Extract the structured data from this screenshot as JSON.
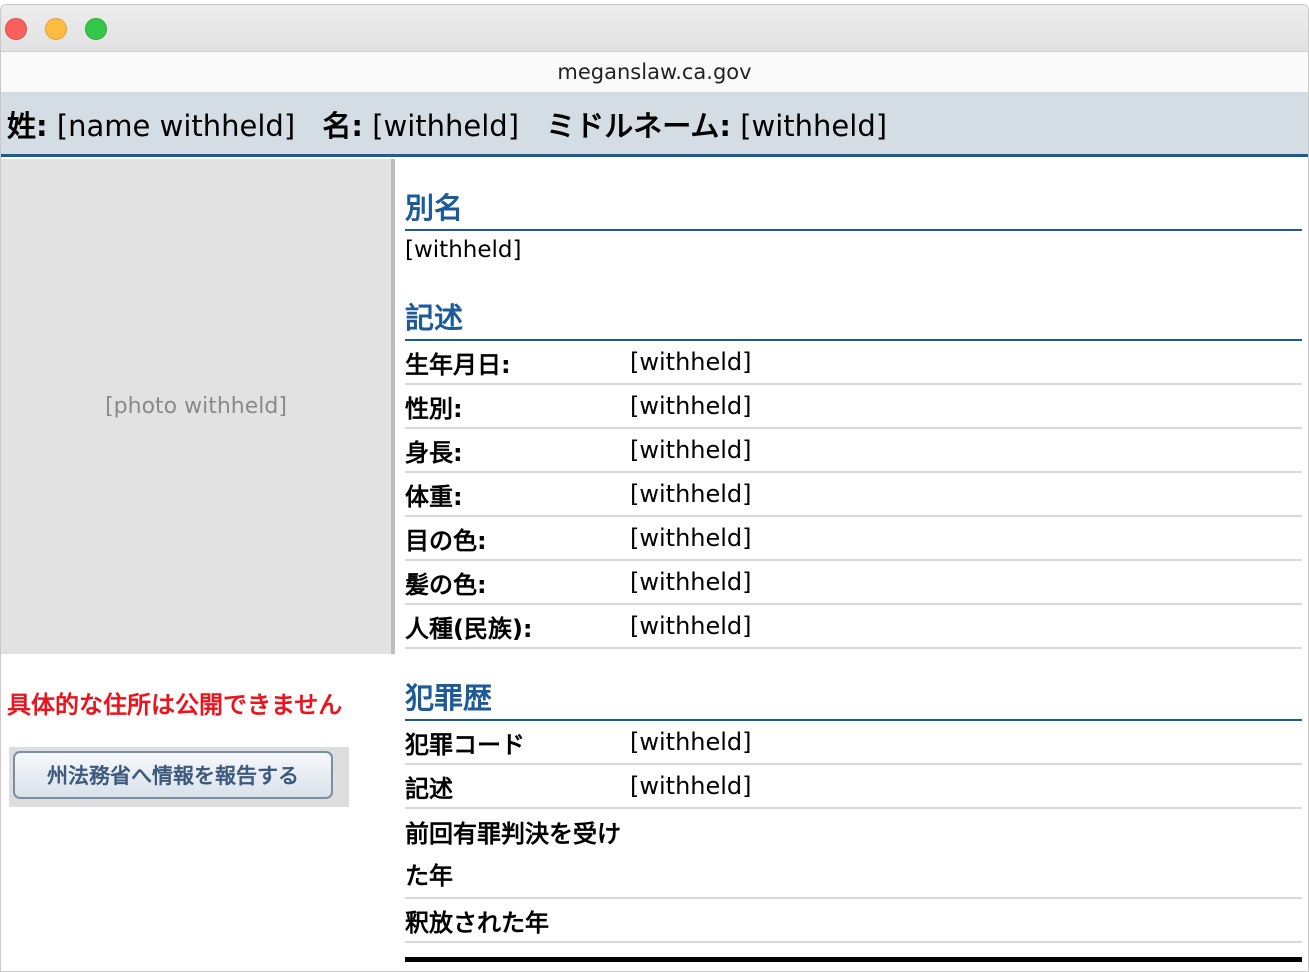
{
  "window": {
    "url": "meganslaw.ca.gov"
  },
  "name_bar": {
    "last_label": "姓:",
    "last_value": "[name withheld]",
    "first_label": "名:",
    "first_value": "[withheld]",
    "middle_label": "ミドルネーム:",
    "middle_value": "[withheld]"
  },
  "photo": {
    "placeholder": "[photo withheld]"
  },
  "notice": "具体的な住所は公開できません",
  "report_button": "州法務省へ情報を報告する",
  "aliases": {
    "title": "別名",
    "value": "[withheld]"
  },
  "description": {
    "title": "記述",
    "rows": [
      {
        "label": "生年月日:",
        "value": "[withheld]"
      },
      {
        "label": "性別:",
        "value": "[withheld]"
      },
      {
        "label": "身長:",
        "value": "[withheld]"
      },
      {
        "label": "体重:",
        "value": "[withheld]"
      },
      {
        "label": "目の色:",
        "value": "[withheld]"
      },
      {
        "label": "髪の色:",
        "value": "[withheld]"
      },
      {
        "label": "人種(民族):",
        "value": "[withheld]"
      }
    ]
  },
  "offenses": {
    "title": "犯罪歴",
    "rows": [
      {
        "label": "犯罪コード",
        "value": "[withheld]"
      },
      {
        "label": "記述",
        "value": "[withheld]"
      },
      {
        "label": "前回有罪判決を受けた年",
        "value": ""
      },
      {
        "label": "釈放された年",
        "value": ""
      }
    ]
  }
}
